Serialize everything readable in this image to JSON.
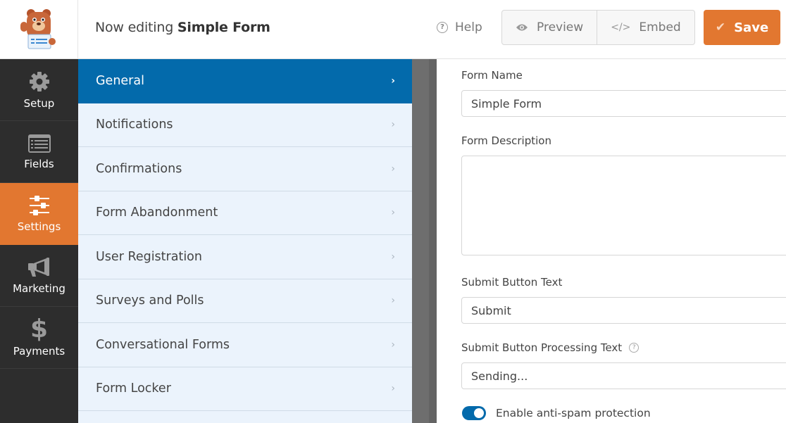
{
  "header": {
    "title_prefix": "Now editing",
    "form_name": "Simple Form",
    "help_label": "Help",
    "preview_label": "Preview",
    "embed_label": "Embed",
    "save_label": "Save"
  },
  "leftnav": {
    "items": [
      {
        "label": "Setup",
        "icon": "gear-icon",
        "active": false
      },
      {
        "label": "Fields",
        "icon": "list-icon",
        "active": false
      },
      {
        "label": "Settings",
        "icon": "sliders-icon",
        "active": true
      },
      {
        "label": "Marketing",
        "icon": "megaphone-icon",
        "active": false
      },
      {
        "label": "Payments",
        "icon": "dollar-icon",
        "active": false
      }
    ]
  },
  "settings_panel": {
    "items": [
      {
        "label": "General",
        "active": true
      },
      {
        "label": "Notifications",
        "active": false
      },
      {
        "label": "Confirmations",
        "active": false
      },
      {
        "label": "Form Abandonment",
        "active": false
      },
      {
        "label": "User Registration",
        "active": false
      },
      {
        "label": "Surveys and Polls",
        "active": false
      },
      {
        "label": "Conversational Forms",
        "active": false
      },
      {
        "label": "Form Locker",
        "active": false
      }
    ],
    "chevron": "›"
  },
  "form": {
    "form_name_label": "Form Name",
    "form_name_value": "Simple Form",
    "form_description_label": "Form Description",
    "form_description_value": "",
    "submit_text_label": "Submit Button Text",
    "submit_text_value": "Submit",
    "processing_text_label": "Submit Button Processing Text",
    "processing_text_value": "Sending...",
    "antispam_label": "Enable anti-spam protection",
    "antispam_enabled": true
  },
  "colors": {
    "accent_orange": "#e27730",
    "accent_blue": "#036aab",
    "nav_dark": "#2d2d2d",
    "panel_bg": "#ebf3fc"
  }
}
